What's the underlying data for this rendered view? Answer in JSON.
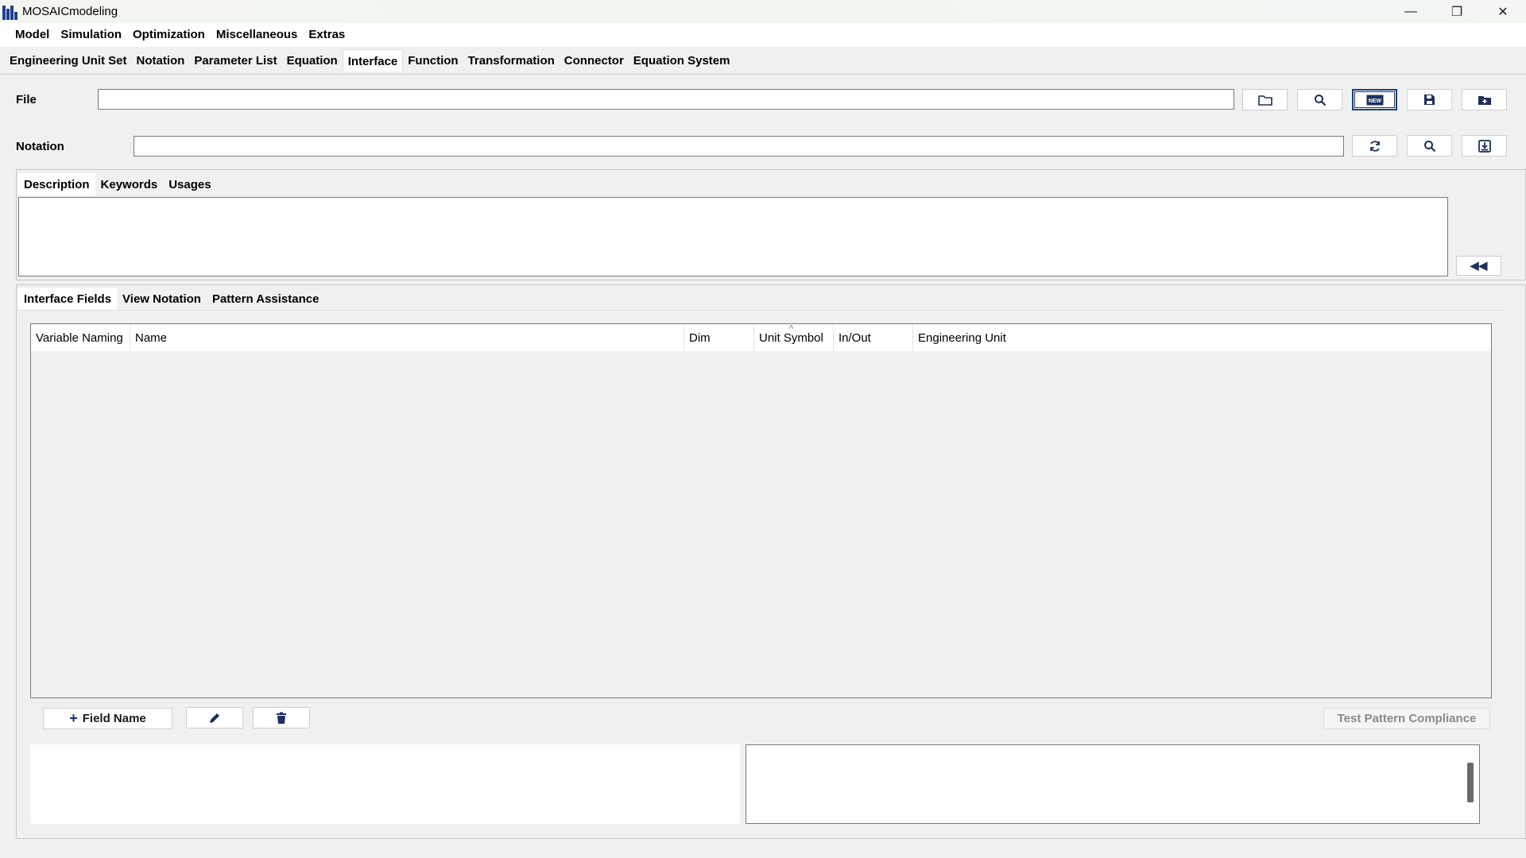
{
  "window": {
    "title": "MOSAICmodeling"
  },
  "window_controls": {
    "minimize": "—",
    "restore": "❐",
    "close": "✕"
  },
  "menu": {
    "items": [
      "Model",
      "Simulation",
      "Optimization",
      "Miscellaneous",
      "Extras"
    ],
    "active": "Model"
  },
  "model_tabs": {
    "items": [
      "Engineering Unit Set",
      "Notation",
      "Parameter List",
      "Equation",
      "Interface",
      "Function",
      "Transformation",
      "Connector",
      "Equation System"
    ],
    "active": "Interface"
  },
  "file_row": {
    "label": "File",
    "value": "",
    "icons": [
      "folder-open-icon",
      "search-icon",
      "new-icon",
      "save-icon",
      "add-folder-icon"
    ],
    "new_badge": "NEW"
  },
  "notation_row": {
    "label": "Notation",
    "value": "",
    "icons": [
      "refresh-icon",
      "search-icon",
      "import-icon"
    ]
  },
  "description_tabs": {
    "items": [
      "Description",
      "Keywords",
      "Usages"
    ],
    "active": "Description"
  },
  "description": {
    "text": "",
    "collapse_label": "◀◀"
  },
  "interface_tabs": {
    "items": [
      "Interface Fields",
      "View Notation",
      "Pattern Assistance"
    ],
    "active": "Interface Fields"
  },
  "fields_table": {
    "columns": [
      "Variable Naming",
      "Name",
      "Dim",
      "Unit Symbol",
      "In/Out",
      "Engineering Unit"
    ],
    "sort_indicator": "^",
    "rows": []
  },
  "actions": {
    "add_label": "Field Name",
    "add_icon": "+",
    "test_label": "Test Pattern Compliance"
  },
  "colors": {
    "accent": "#1c2f5e",
    "focus": "#0f3f8a"
  }
}
